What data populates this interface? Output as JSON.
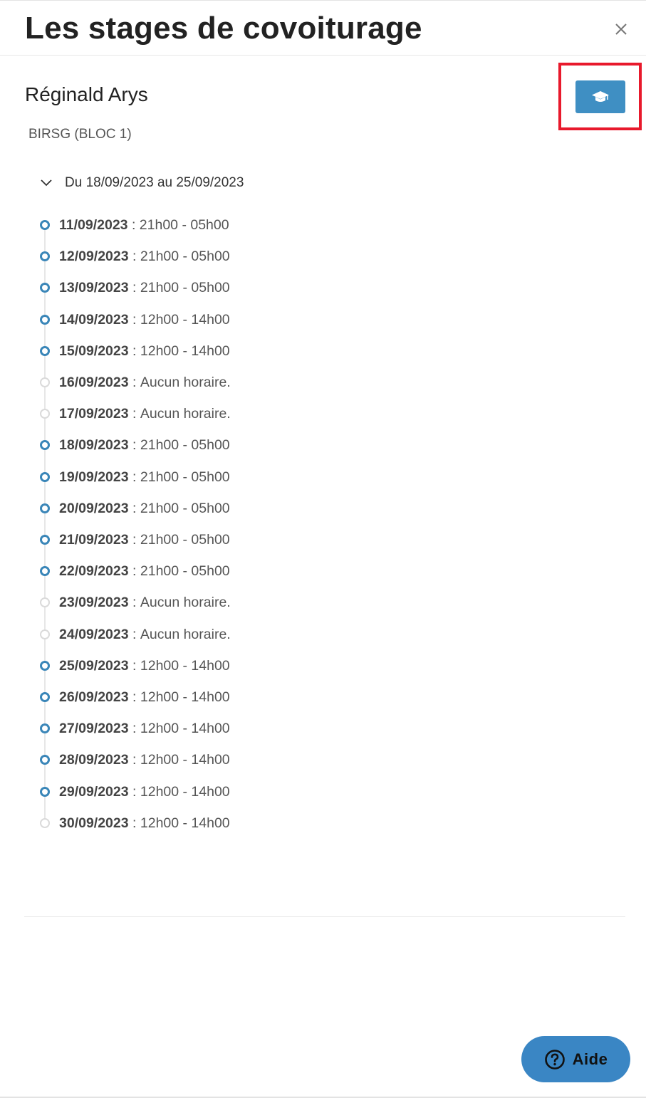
{
  "header": {
    "title": "Les stages de covoiturage",
    "close_icon": "close-icon"
  },
  "student": {
    "name": "Réginald Arys",
    "group": "BIRSG (BLOC 1)"
  },
  "toolbar": {
    "graduation_icon": "graduation-cap-icon",
    "accent_color": "#3f8fc3",
    "highlight_color": "#e8192c"
  },
  "period": {
    "label": "Du 18/09/2023 au 25/09/2023",
    "expand_icon": "chevron-down-icon"
  },
  "schedule": [
    {
      "date": "11/09/2023",
      "sep": " : ",
      "hours": "21h00 - 05h00",
      "active": true
    },
    {
      "date": "12/09/2023",
      "sep": " : ",
      "hours": "21h00 - 05h00",
      "active": true
    },
    {
      "date": "13/09/2023",
      "sep": " : ",
      "hours": "21h00 - 05h00",
      "active": true
    },
    {
      "date": "14/09/2023",
      "sep": " : ",
      "hours": "12h00 - 14h00",
      "active": true
    },
    {
      "date": "15/09/2023",
      "sep": " : ",
      "hours": "12h00 - 14h00",
      "active": true
    },
    {
      "date": "16/09/2023",
      "sep": " : ",
      "hours": "Aucun horaire.",
      "active": false
    },
    {
      "date": "17/09/2023",
      "sep": " : ",
      "hours": "Aucun horaire.",
      "active": false
    },
    {
      "date": "18/09/2023",
      "sep": " : ",
      "hours": "21h00 - 05h00",
      "active": true
    },
    {
      "date": "19/09/2023",
      "sep": " : ",
      "hours": "21h00 - 05h00",
      "active": true
    },
    {
      "date": "20/09/2023",
      "sep": " : ",
      "hours": "21h00 - 05h00",
      "active": true
    },
    {
      "date": "21/09/2023",
      "sep": " : ",
      "hours": "21h00 - 05h00",
      "active": true
    },
    {
      "date": "22/09/2023",
      "sep": " : ",
      "hours": "21h00 - 05h00",
      "active": true
    },
    {
      "date": "23/09/2023",
      "sep": " : ",
      "hours": "Aucun horaire.",
      "active": false
    },
    {
      "date": "24/09/2023",
      "sep": " : ",
      "hours": "Aucun horaire.",
      "active": false
    },
    {
      "date": "25/09/2023",
      "sep": " : ",
      "hours": "12h00 - 14h00",
      "active": true
    },
    {
      "date": "26/09/2023",
      "sep": " : ",
      "hours": "12h00 - 14h00",
      "active": true
    },
    {
      "date": "27/09/2023",
      "sep": " : ",
      "hours": "12h00 - 14h00",
      "active": true
    },
    {
      "date": "28/09/2023",
      "sep": " : ",
      "hours": "12h00 - 14h00",
      "active": true
    },
    {
      "date": "29/09/2023",
      "sep": " : ",
      "hours": "12h00 - 14h00",
      "active": true
    },
    {
      "date": "30/09/2023",
      "sep": " : ",
      "hours": "12h00 - 14h00",
      "active": false
    }
  ],
  "help": {
    "label": "Aide",
    "icon": "question-circle-icon"
  }
}
